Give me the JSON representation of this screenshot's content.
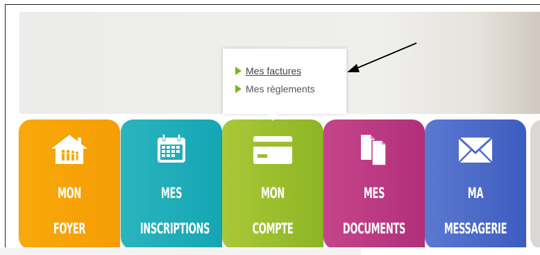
{
  "dropdown": {
    "items": [
      {
        "label": "Mes factures",
        "active": true
      },
      {
        "label": "Mes règlements",
        "active": false
      }
    ]
  },
  "tiles": [
    {
      "line1": "MON",
      "line2": "FOYER",
      "icon": "house-family-icon",
      "color": "#f7a90a"
    },
    {
      "line1": "MES",
      "line2": "INSCRIPTIONS",
      "icon": "calendar-icon",
      "color": "#1fadb9"
    },
    {
      "line1": "MON",
      "line2": "COMPTE",
      "icon": "card-icon",
      "color": "#9cbe2e"
    },
    {
      "line1": "MES",
      "line2": "DOCUMENTS",
      "icon": "documents-icon",
      "color": "#bb3a82"
    },
    {
      "line1": "MA",
      "line2": "MESSAGERIE",
      "icon": "envelope-icon",
      "color": "#4d6bc8"
    }
  ]
}
